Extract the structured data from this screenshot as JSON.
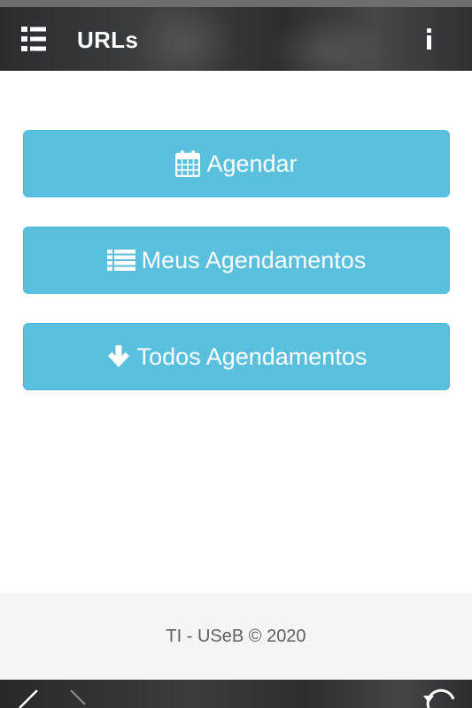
{
  "header": {
    "title": "URLs",
    "menu_icon": "list-menu-icon",
    "info_icon": "info-icon"
  },
  "buttons": [
    {
      "label": "Agendar",
      "icon": "calendar-icon"
    },
    {
      "label": "Meus Agendamentos",
      "icon": "list-icon"
    },
    {
      "label": "Todos Agendamentos",
      "icon": "arrow-down-icon"
    }
  ],
  "footer": {
    "text": "TI - USeB © 2020"
  },
  "colors": {
    "button_bg": "#5bc0de",
    "button_border": "#46b8da",
    "header_bg": "#2f3133",
    "footer_bg": "#f5f5f5",
    "footer_text": "#5f5f5f"
  }
}
